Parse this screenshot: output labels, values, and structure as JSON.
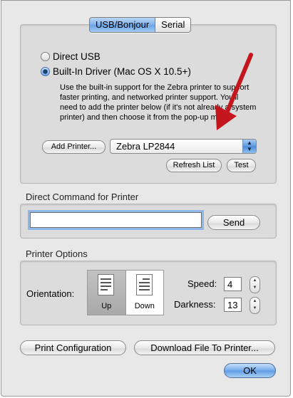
{
  "tabs": [
    {
      "label": "USB/Bonjour",
      "selected": true
    },
    {
      "label": "Serial",
      "selected": false
    }
  ],
  "connection": {
    "options": [
      {
        "label": "Direct USB",
        "selected": false
      },
      {
        "label": "Built-In Driver (Mac OS X 10.5+)",
        "selected": true
      }
    ],
    "description": "Use the built-in support for the Zebra printer to support faster printing, and networked printer support. You'll need to add the printer below (if it's not already a system printer) and then choose it from the pop-up menu.",
    "add_printer_label": "Add Printer...",
    "printer_selected": "Zebra LP2844",
    "refresh_label": "Refresh List",
    "test_label": "Test"
  },
  "direct_command": {
    "heading": "Direct Command for Printer",
    "input_value": "",
    "send_label": "Send"
  },
  "printer_options": {
    "heading": "Printer Options",
    "orientation_label": "Orientation:",
    "orientation_options": [
      {
        "label": "Up",
        "selected": true
      },
      {
        "label": "Down",
        "selected": false
      }
    ],
    "speed_label": "Speed:",
    "speed_value": "4",
    "darkness_label": "Darkness:",
    "darkness_value": "13"
  },
  "footer": {
    "print_config_label": "Print Configuration",
    "download_label": "Download File To Printer...",
    "ok_label": "OK"
  },
  "colors": {
    "annotation_arrow": "#c4161c",
    "accent_blue": "#6aa3e6",
    "window_bg": "#e8e8e8"
  }
}
